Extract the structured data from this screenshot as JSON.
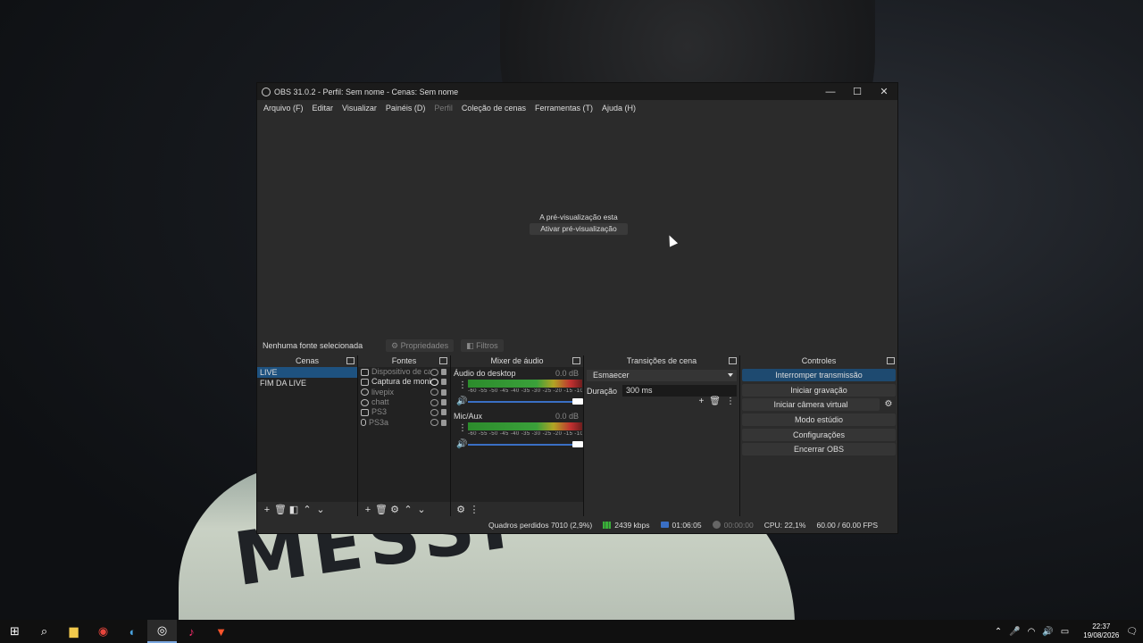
{
  "window": {
    "title": "OBS 31.0.2 - Perfil: Sem nome - Cenas: Sem nome",
    "minimize": "—",
    "maximize": "☐",
    "close": "✕"
  },
  "menu": [
    {
      "label": "Arquivo (F)",
      "disabled": false
    },
    {
      "label": "Editar",
      "disabled": false
    },
    {
      "label": "Visualizar",
      "disabled": false
    },
    {
      "label": "Painéis (D)",
      "disabled": false
    },
    {
      "label": "Perfil",
      "disabled": true
    },
    {
      "label": "Coleção de cenas",
      "disabled": false
    },
    {
      "label": "Ferramentas (T)",
      "disabled": false
    },
    {
      "label": "Ajuda (H)",
      "disabled": false
    }
  ],
  "preview": {
    "message": "A pré-visualização esta desativada",
    "enable_button": "Ativar pré-visualização"
  },
  "properties_bar": {
    "no_source": "Nenhuma fonte selecionada",
    "properties": "Propriedades",
    "filters": "Filtros"
  },
  "scenes": {
    "title": "Cenas",
    "items": [
      "LIVE",
      "FIM DA LIVE"
    ],
    "selected": "LIVE"
  },
  "sources": {
    "title": "Fontes",
    "items": [
      {
        "name": "Dispositivo de captura",
        "icon": "camera-icon",
        "visible": false
      },
      {
        "name": "Captura de monitor",
        "icon": "monitor-icon",
        "visible": true
      },
      {
        "name": "livepix",
        "icon": "globe-icon",
        "visible": false
      },
      {
        "name": "chatt",
        "icon": "globe-icon",
        "visible": false
      },
      {
        "name": "PS3",
        "icon": "camera-icon",
        "visible": false
      },
      {
        "name": "PS3a",
        "icon": "mic-icon",
        "visible": false
      }
    ]
  },
  "mixer": {
    "title": "Mixer de áudio",
    "ticks": "-60 -55 -50 -45 -40 -35 -30 -25 -20 -15 -10 -5 0",
    "channels": [
      {
        "name": "Áudio do desktop",
        "db": "0.0 dB"
      },
      {
        "name": "Mic/Aux",
        "db": "0.0 dB"
      }
    ]
  },
  "transitions": {
    "title": "Transições de cena",
    "selected": "Esmaecer",
    "duration_label": "Duração",
    "duration_value": "300 ms"
  },
  "controls": {
    "title": "Controles",
    "stop_stream": "Interromper transmissão",
    "start_recording": "Iniciar gravação",
    "start_virtual_cam": "Iniciar câmera virtual",
    "studio_mode": "Modo estúdio",
    "settings": "Configurações",
    "exit": "Encerrar OBS"
  },
  "status": {
    "dropped_frames": "Quadros perdidos 7010 (2,9%)",
    "bitrate": "2439 kbps",
    "live_time": "01:06:05",
    "rec_time": "00:00:00",
    "cpu": "CPU: 22,1%",
    "fps": "60.00 / 60.00 FPS"
  },
  "taskbar": {
    "time": "22:37",
    "date": "19/08/2026"
  },
  "colors": {
    "accent": "#1e5280",
    "window_bg": "#2b2b2b",
    "dock_bg": "#222222"
  }
}
